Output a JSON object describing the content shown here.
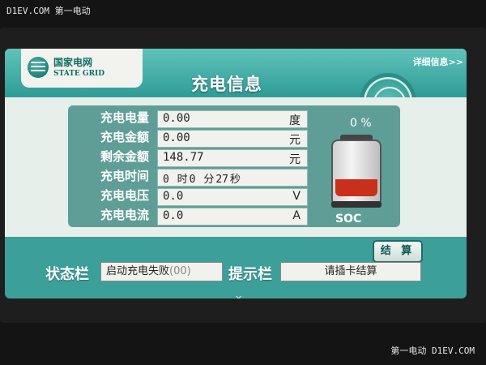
{
  "watermark": {
    "top": "D1EV.COM 第一电动",
    "bottom": "第一电动 D1EV.COM"
  },
  "header": {
    "brand_cn": "国家电网",
    "brand_en": "STATE GRID",
    "title": "充电信息",
    "detail_link": "详细信息>>"
  },
  "info": {
    "rows": [
      {
        "label": "充电电量",
        "value": "0.00",
        "unit": "度"
      },
      {
        "label": "充电金额",
        "value": "0.00",
        "unit": "元"
      },
      {
        "label": "剩余金额",
        "value": "148.77",
        "unit": "元"
      },
      {
        "label": "充电时间",
        "hours": "0",
        "hour_unit": "时",
        "minutes": "0",
        "minute_unit": "分",
        "seconds": "27",
        "second_unit": "秒"
      },
      {
        "label": "充电电压",
        "value": "0.0",
        "unit": "V"
      },
      {
        "label": "充电电流",
        "value": "0.0",
        "unit": "A"
      }
    ]
  },
  "battery": {
    "percent_text": "0 %",
    "label": "SOC",
    "fill_fraction": 0.35,
    "fill_color": "#c9301b"
  },
  "actions": {
    "settle_label": "结 算"
  },
  "status": {
    "label": "状态栏",
    "message": "启动充电失败",
    "code": "(00)",
    "hint_label": "提示栏",
    "hint_message": "请插卡结算"
  },
  "colors": {
    "screen_teal": "#3c9f9a",
    "panel": "#5f9e97",
    "content_bg": "#e6efe9"
  },
  "icons": {
    "brand": "state-grid-logo-icon",
    "seal": "corporation-seal-icon",
    "battery": "battery-icon"
  }
}
